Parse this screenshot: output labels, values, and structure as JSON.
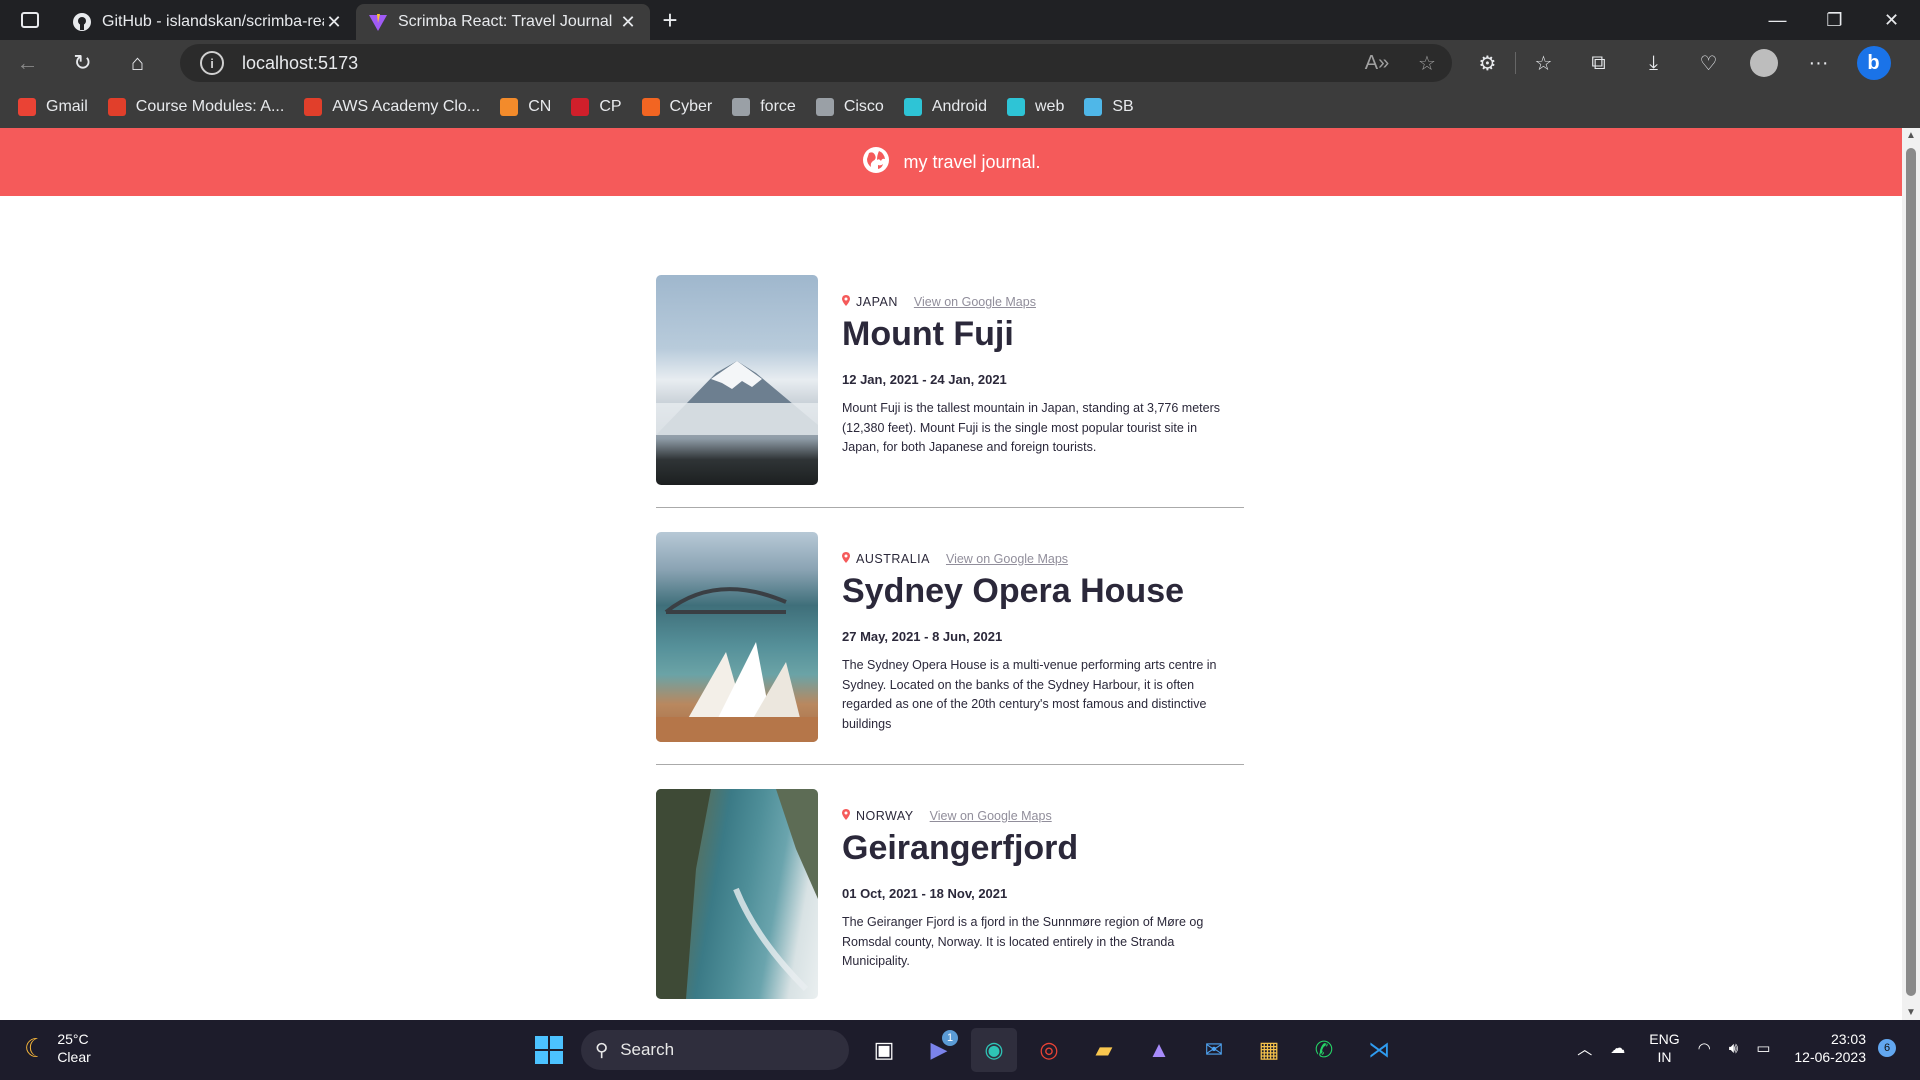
{
  "browser": {
    "tabs": [
      {
        "title": "GitHub - islandskan/scrimba-react",
        "active": false
      },
      {
        "title": "Scrimba React: Travel Journal",
        "active": true
      }
    ],
    "address": "localhost:5173",
    "bookmarks": [
      {
        "label": "Gmail",
        "icon": "gmail-icon",
        "color": "#ea4335"
      },
      {
        "label": "Course Modules: A...",
        "icon": "canvas-icon",
        "color": "#e13f2b"
      },
      {
        "label": "AWS Academy Clo...",
        "icon": "canvas-icon",
        "color": "#e13f2b"
      },
      {
        "label": "CN",
        "icon": "cn-icon",
        "color": "#f38b2b"
      },
      {
        "label": "CP",
        "icon": "cp-icon",
        "color": "#d01f2b"
      },
      {
        "label": "Cyber",
        "icon": "cyber-icon",
        "color": "#f26522"
      },
      {
        "label": "force",
        "icon": "document-icon",
        "color": "#9aa0a6"
      },
      {
        "label": "Cisco",
        "icon": "cisco-icon",
        "color": "#9aa0a6"
      },
      {
        "label": "Android",
        "icon": "android-icon",
        "color": "#2ec4d6"
      },
      {
        "label": "web",
        "icon": "web-icon",
        "color": "#2ec4d6"
      },
      {
        "label": "SB",
        "icon": "sb-icon",
        "color": "#4fb7e8"
      }
    ]
  },
  "app": {
    "title": "my travel journal.",
    "accent": "#f55a5a"
  },
  "entries": [
    {
      "country": "JAPAN",
      "maps_link": "View on Google Maps",
      "title": "Mount Fuji",
      "dates": "12 Jan, 2021 - 24 Jan, 2021",
      "description": "Mount Fuji is the tallest mountain in Japan, standing at 3,776 meters (12,380 feet). Mount Fuji is the single most popular tourist site in Japan, for both Japanese and foreign tourists."
    },
    {
      "country": "AUSTRALIA",
      "maps_link": "View on Google Maps",
      "title": "Sydney Opera House",
      "dates": "27 May, 2021 - 8 Jun, 2021",
      "description": "The Sydney Opera House is a multi-venue performing arts centre in Sydney. Located on the banks of the Sydney Harbour, it is often regarded as one of the 20th century's most famous and distinctive buildings"
    },
    {
      "country": "NORWAY",
      "maps_link": "View on Google Maps",
      "title": "Geirangerfjord",
      "dates": "01 Oct, 2021 - 18 Nov, 2021",
      "description": "The Geiranger Fjord is a fjord in the Sunnmøre region of Møre og Romsdal county, Norway. It is located entirely in the Stranda Municipality."
    }
  ],
  "taskbar": {
    "weather_temp": "25°C",
    "weather_desc": "Clear",
    "search_label": "Search",
    "teams_badge": "1",
    "lang_line1": "ENG",
    "lang_line2": "IN",
    "time": "23:03",
    "date": "12-06-2023",
    "notifications": "6"
  }
}
